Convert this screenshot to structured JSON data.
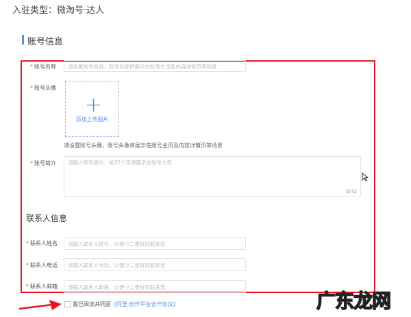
{
  "entry_type": "入驻类型：微淘号·达人",
  "section_account": "账号信息",
  "fields": {
    "name": {
      "label": "账号名称",
      "placeholder": "请设置账号名称，账号名称将展示在账号主页及内容详情页等场景"
    },
    "avatar": {
      "label": "账号头像",
      "upload_label": "添加上传图片",
      "hint": "请设置账号头像，账号头像将展示在账号主页及内容详情页等场景"
    },
    "intro": {
      "label": "账号简介",
      "placeholder": "请输入账号简介，前32个字将展示在账号主页",
      "counter": "0/72"
    }
  },
  "section_contact": "联系人信息",
  "contact": [
    {
      "label": "联系人姓名",
      "placeholder": "请输入联系人姓名，以便小二更好的联系您"
    },
    {
      "label": "联系人电话",
      "placeholder": "请输入联系人电话，以便小二更好的联系您"
    },
    {
      "label": "联系人邮箱",
      "placeholder": "请输入联系人邮箱，以便小二更好的联系您"
    }
  ],
  "agreement": {
    "text": "我已阅读并同意",
    "link": "《阿里·创作平台合作协议》",
    "checked": false
  },
  "required_mark": "*",
  "watermark": "广东龙网",
  "colors": {
    "accent": "#5b8fe0",
    "highlight": "#e8141e"
  }
}
